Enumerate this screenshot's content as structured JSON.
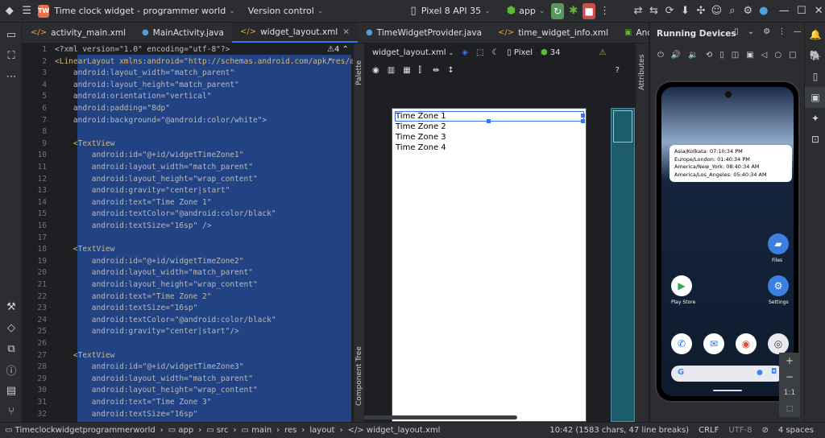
{
  "titlebar": {
    "project_badge": "TW",
    "project_title": "Time clock widget - programmer world",
    "vcs": "Version control",
    "device": "Pixel 8 API 35",
    "run_config": "app"
  },
  "tabs": [
    {
      "label": "activity_main.xml",
      "icon": "xml-icon"
    },
    {
      "label": "MainActivity.java",
      "icon": "class-icon"
    },
    {
      "label": "widget_layout.xml",
      "icon": "xml-icon",
      "active": true
    },
    {
      "label": "TimeWidgetProvider.java",
      "icon": "class-icon"
    },
    {
      "label": "time_widget_info.xml",
      "icon": "xml-icon"
    },
    {
      "label": "AndroidM",
      "icon": "manifest-icon"
    }
  ],
  "editor": {
    "warning_count": "4",
    "lines": [
      {
        "n": "1",
        "text": "<?xml version=\"1.0\" encoding=\"utf-8\"?>"
      },
      {
        "n": "2",
        "text": "<LinearLayout xmlns:android=\"http://schemas.android.com/apk/res/andro"
      },
      {
        "n": "3",
        "text": "    android:layout_width=\"match_parent\""
      },
      {
        "n": "4",
        "text": "    android:layout_height=\"match_parent\""
      },
      {
        "n": "5",
        "text": "    android:orientation=\"vertical\""
      },
      {
        "n": "6",
        "text": "    android:padding=\"8dp\""
      },
      {
        "n": "7",
        "text": "    android:background=\"@android:color/white\">"
      },
      {
        "n": "8",
        "text": ""
      },
      {
        "n": "9",
        "text": "    <TextView"
      },
      {
        "n": "10",
        "text": "        android:id=\"@+id/widgetTimeZone1\""
      },
      {
        "n": "11",
        "text": "        android:layout_width=\"match_parent\""
      },
      {
        "n": "12",
        "text": "        android:layout_height=\"wrap_content\""
      },
      {
        "n": "13",
        "text": "        android:gravity=\"center|start\""
      },
      {
        "n": "14",
        "text": "        android:text=\"Time Zone 1\""
      },
      {
        "n": "15",
        "text": "        android:textColor=\"@android:color/black\""
      },
      {
        "n": "16",
        "text": "        android:textSize=\"16sp\" />"
      },
      {
        "n": "17",
        "text": ""
      },
      {
        "n": "18",
        "text": "    <TextView"
      },
      {
        "n": "19",
        "text": "        android:id=\"@+id/widgetTimeZone2\""
      },
      {
        "n": "20",
        "text": "        android:layout_width=\"match_parent\""
      },
      {
        "n": "21",
        "text": "        android:layout_height=\"wrap_content\""
      },
      {
        "n": "22",
        "text": "        android:text=\"Time Zone 2\""
      },
      {
        "n": "23",
        "text": "        android:textSize=\"16sp\""
      },
      {
        "n": "24",
        "text": "        android:textColor=\"@android:color/black\""
      },
      {
        "n": "25",
        "text": "        android:gravity=\"center|start\"/>"
      },
      {
        "n": "26",
        "text": ""
      },
      {
        "n": "27",
        "text": "    <TextView"
      },
      {
        "n": "28",
        "text": "        android:id=\"@+id/widgetTimeZone3\""
      },
      {
        "n": "29",
        "text": "        android:layout_width=\"match_parent\""
      },
      {
        "n": "30",
        "text": "        android:layout_height=\"wrap_content\""
      },
      {
        "n": "31",
        "text": "        android:text=\"Time Zone 3\""
      },
      {
        "n": "32",
        "text": "        android:textSize=\"16sp\""
      }
    ]
  },
  "palette_label": "Palette",
  "component_tree_label": "Component Tree",
  "attributes_label": "Attributes",
  "design": {
    "file": "widget_layout.xml",
    "device": "Pixel",
    "api": "34",
    "help": "?",
    "textviews": [
      "Time Zone 1",
      "Time Zone 2",
      "Time Zone 3",
      "Time Zone 4"
    ]
  },
  "running": {
    "title": "Running Devices",
    "widget_lines": [
      "Asia/Kolkata: 07:10:34 PM",
      "Europe/London: 01:40:34 PM",
      "America/New_York: 08:40:34 AM",
      "America/Los_Angeles: 05:40:34 AM"
    ],
    "apps": {
      "files": "Files",
      "play": "Play Store",
      "settings": "Settings"
    },
    "zoom_plus": "+",
    "zoom_minus": "−",
    "zoom_ratio": "1:1"
  },
  "statusbar": {
    "breadcrumb": [
      "Timeclockwidgetprogrammerworld",
      "app",
      "src",
      "main",
      "res",
      "layout",
      "widget_layout.xml"
    ],
    "position": "10:42 (1583 chars, 47 line breaks)",
    "line_sep": "CRLF",
    "encoding": "UTF-8",
    "indent": "4 spaces"
  }
}
